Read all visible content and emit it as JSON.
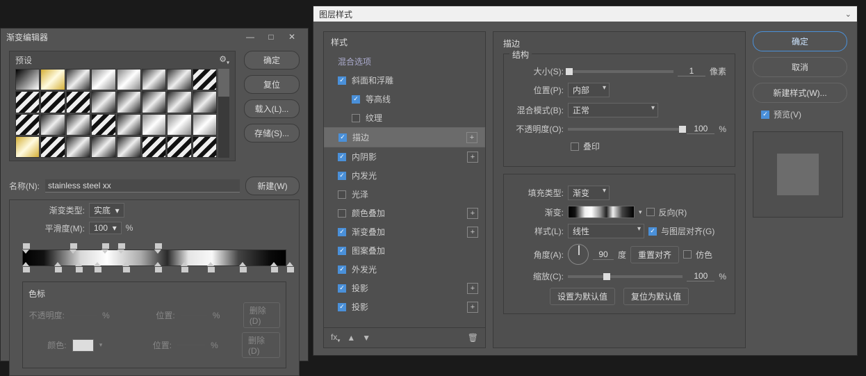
{
  "gradientEditor": {
    "title": "渐变编辑器",
    "presetsLabel": "预设",
    "buttons": {
      "ok": "确定",
      "reset": "复位",
      "load": "载入(L)...",
      "save": "存储(S)...",
      "new": "新建(W)"
    },
    "nameLabel": "名称(N):",
    "nameValue": "stainless steel xx",
    "gradientTypeLabel": "渐变类型:",
    "gradientTypeValue": "实底",
    "smoothnessLabel": "平滑度(M):",
    "smoothnessValue": "100",
    "percent": "%",
    "stopsPanel": {
      "title": "色标",
      "opacityLabel": "不透明度:",
      "positionLabel": "位置:",
      "colorLabel": "颜色:",
      "delete": "删除(D)"
    },
    "topStops": [
      0,
      18,
      30,
      36,
      50
    ],
    "botStops": [
      0,
      12,
      20,
      27,
      38,
      50,
      60,
      70,
      82,
      94,
      100
    ]
  },
  "layerStyle": {
    "title": "图层样式",
    "styleHeader": "样式",
    "blendOptions": "混合选项",
    "items": [
      {
        "label": "斜面和浮雕",
        "checked": true,
        "plus": false
      },
      {
        "label": "等高线",
        "checked": true,
        "plus": false,
        "sub": true
      },
      {
        "label": "纹理",
        "checked": false,
        "plus": false,
        "sub": true
      },
      {
        "label": "描边",
        "checked": true,
        "plus": true,
        "selected": true
      },
      {
        "label": "内阴影",
        "checked": true,
        "plus": true
      },
      {
        "label": "内发光",
        "checked": true,
        "plus": false
      },
      {
        "label": "光泽",
        "checked": false,
        "plus": false
      },
      {
        "label": "颜色叠加",
        "checked": false,
        "plus": true
      },
      {
        "label": "渐变叠加",
        "checked": true,
        "plus": true
      },
      {
        "label": "图案叠加",
        "checked": true,
        "plus": false
      },
      {
        "label": "外发光",
        "checked": true,
        "plus": false
      },
      {
        "label": "投影",
        "checked": true,
        "plus": true
      },
      {
        "label": "投影",
        "checked": true,
        "plus": true
      }
    ],
    "stroke": {
      "sectionTitle": "描边",
      "structureTitle": "结构",
      "sizeLabel": "大小(S):",
      "sizeValue": "1",
      "sizeUnit": "像素",
      "positionLabel": "位置(P):",
      "positionValue": "内部",
      "blendModeLabel": "混合模式(B):",
      "blendModeValue": "正常",
      "opacityLabel": "不透明度(O):",
      "opacityValue": "100",
      "overprint": "叠印",
      "fillTypeLabel": "填充类型:",
      "fillTypeValue": "渐变",
      "gradientLabel": "渐变:",
      "reverseLabel": "反向(R)",
      "styleLabel": "样式(L):",
      "styleValue": "线性",
      "alignLabel": "与图层对齐(G)",
      "angleLabel": "角度(A):",
      "angleValue": "90",
      "angleUnit": "度",
      "resetAlign": "重置对齐",
      "ditherLabel": "仿色",
      "scaleLabel": "缩放(C):",
      "scaleValue": "100",
      "setDefault": "设置为默认值",
      "resetDefault": "复位为默认值"
    },
    "right": {
      "ok": "确定",
      "cancel": "取消",
      "newStyle": "新建样式(W)...",
      "preview": "预览(V)"
    }
  }
}
